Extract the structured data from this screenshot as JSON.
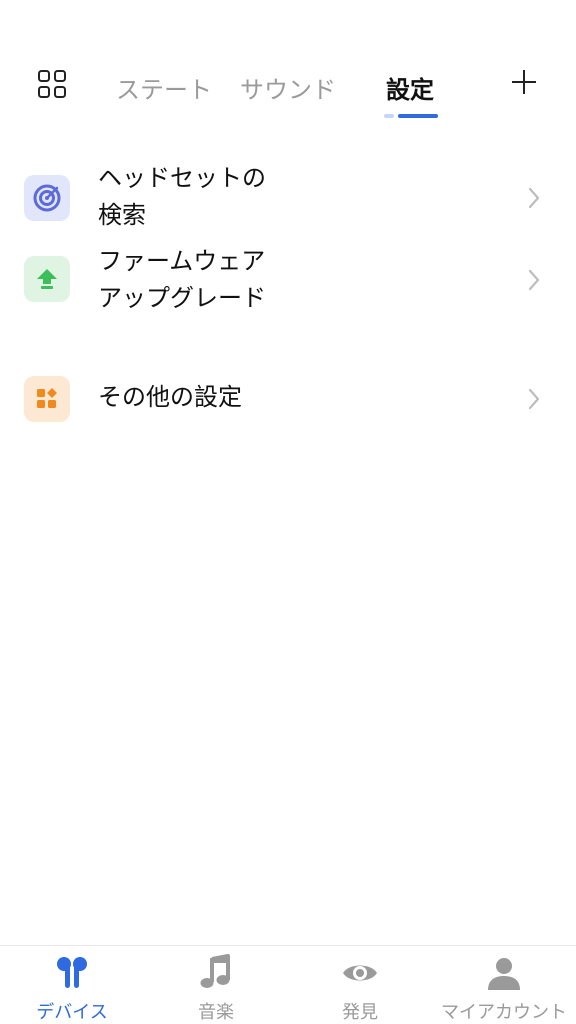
{
  "header": {
    "tabs": [
      {
        "label": "ステート"
      },
      {
        "label": "サウンド"
      },
      {
        "label": "設定"
      }
    ],
    "active_tab": "設定"
  },
  "settings": {
    "items": [
      {
        "label_line1": "ヘッドセットの",
        "label_line2": "検索",
        "icon": "radar-target-icon",
        "color": "#5b6bdc"
      },
      {
        "label_line1": "ファームウェア",
        "label_line2": "アップグレード",
        "icon": "upload-arrow-icon",
        "color": "#3cbf5a"
      },
      {
        "label_line1": "その他の設定",
        "icon": "more-settings-grid-icon",
        "color": "#f08a1c"
      }
    ]
  },
  "bottom_nav": {
    "items": [
      {
        "label": "デバイス",
        "icon": "earbuds-icon",
        "active": true
      },
      {
        "label": "音楽",
        "icon": "music-note-icon",
        "active": false
      },
      {
        "label": "発見",
        "icon": "eye-icon",
        "active": false
      },
      {
        "label": "マイアカウント",
        "icon": "person-icon",
        "active": false
      }
    ]
  },
  "colors": {
    "accent": "#2f6ae0",
    "inactive": "#9a9a9a",
    "text": "#111111"
  }
}
